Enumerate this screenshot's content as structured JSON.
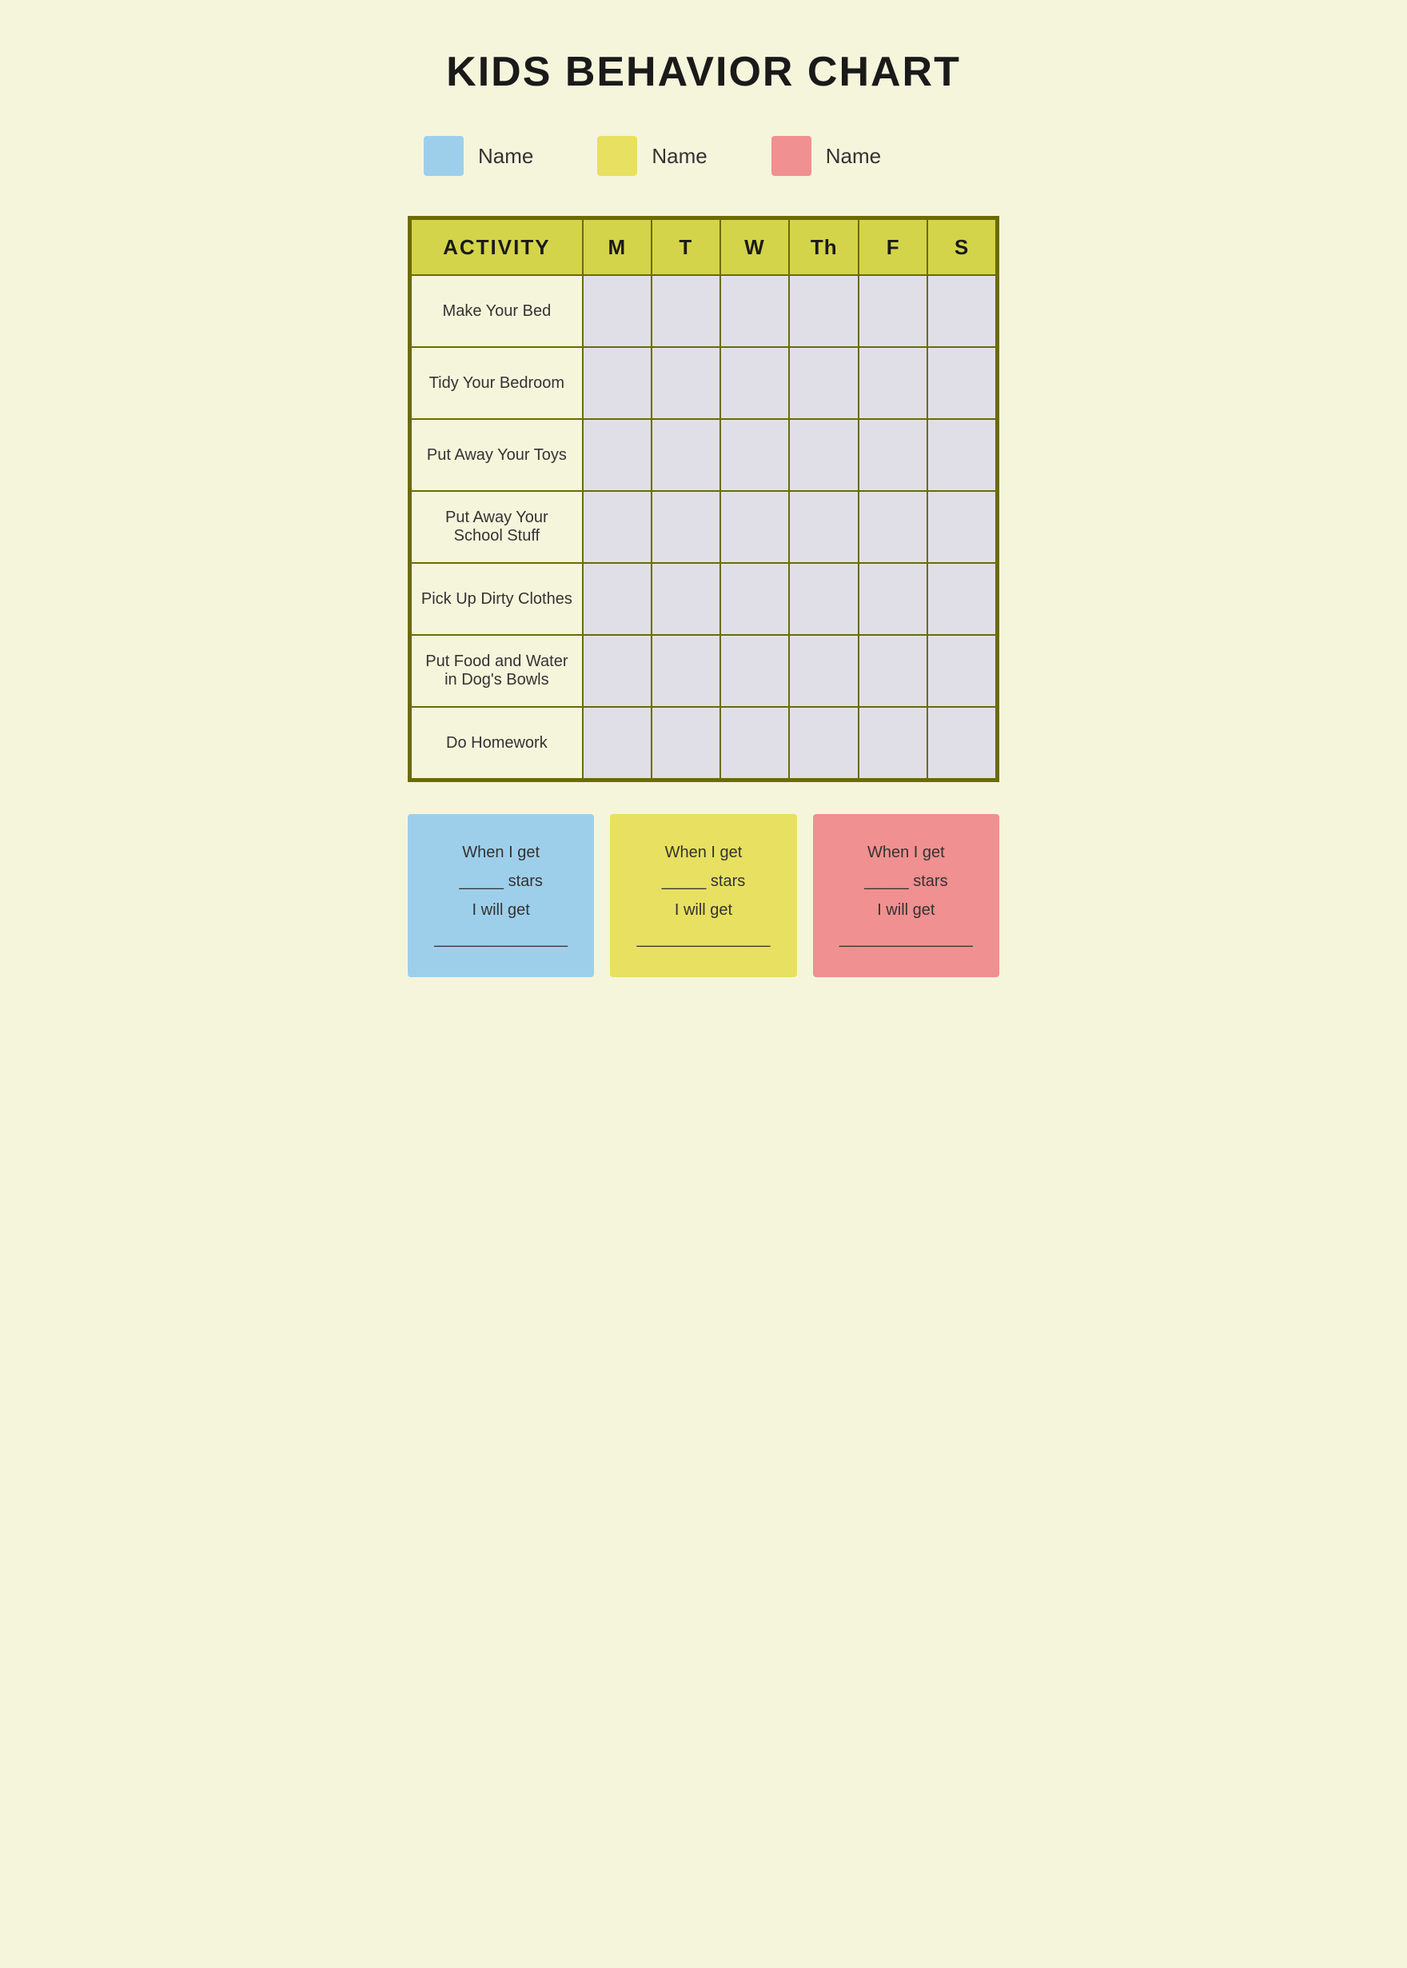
{
  "title": "KIDS BEHAVIOR CHART",
  "legend": {
    "items": [
      {
        "color": "#9ecfea",
        "label": "Name"
      },
      {
        "color": "#e8e060",
        "label": "Name"
      },
      {
        "color": "#f09090",
        "label": "Name"
      }
    ]
  },
  "table": {
    "header": {
      "activity": "ACTIVITY",
      "days": [
        "M",
        "T",
        "W",
        "Th",
        "F",
        "S"
      ]
    },
    "rows": [
      {
        "activity": "Make Your Bed"
      },
      {
        "activity": "Tidy Your Bedroom"
      },
      {
        "activity": "Put Away Your Toys"
      },
      {
        "activity": "Put Away Your School Stuff"
      },
      {
        "activity": "Pick Up Dirty Clothes"
      },
      {
        "activity": "Put Food and Water in Dog's Bowls"
      },
      {
        "activity": "Do Homework"
      }
    ]
  },
  "rewards": [
    {
      "color": "#9ecfea",
      "line1": "When I get",
      "line2": "_____ stars",
      "line3": "I will get",
      "line4": "_______________"
    },
    {
      "color": "#e8e060",
      "line1": "When I get",
      "line2": "_____ stars",
      "line3": "I will get",
      "line4": "_______________"
    },
    {
      "color": "#f09090",
      "line1": "When I get",
      "line2": "_____ stars",
      "line3": "I will get",
      "line4": "_______________"
    }
  ]
}
